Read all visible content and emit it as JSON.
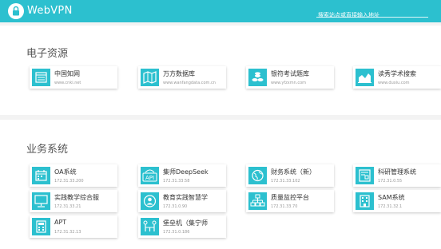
{
  "header": {
    "brand": "WebVPN",
    "search_placeholder": "搜索站点或直接输入地址"
  },
  "resources": {
    "title": "电子资源",
    "items": [
      {
        "name": "中国知网",
        "url": "www.cnki.net",
        "icon": "list-icon"
      },
      {
        "name": "万方数据库",
        "url": "www.wanfangdata.com.cn",
        "icon": "map-icon"
      },
      {
        "name": "银符考试题库",
        "url": "www.yfzxmn.com",
        "icon": "coins-icon"
      },
      {
        "name": "读秀学术搜索",
        "url": "www.duxiu.com",
        "icon": "chart-icon"
      }
    ]
  },
  "business": {
    "title": "业务系统",
    "items": [
      {
        "name": "OA系统",
        "url": "172.31.33.200",
        "icon": "calendar-icon"
      },
      {
        "name": "集师DeepSeek",
        "url": "172.31.33.58",
        "icon": "api-icon"
      },
      {
        "name": "财务系统（新）",
        "url": "172.31.33.102",
        "icon": "globe-icon"
      },
      {
        "name": "科研管理系统",
        "url": "172.31.0.55",
        "icon": "document-icon"
      },
      {
        "name": "实践教学综合服",
        "url": "172.31.33.21",
        "icon": "monitor-icon"
      },
      {
        "name": "教育实践智慧学",
        "url": "172.31.0.90",
        "icon": "user-icon"
      },
      {
        "name": "质量监控平台",
        "url": "172.31.33.70",
        "icon": "network-icon"
      },
      {
        "name": "SAM系统",
        "url": "172.31.32.1",
        "icon": "building-icon"
      },
      {
        "name": "APT",
        "url": "172.31.32.13",
        "icon": "calculator-icon"
      },
      {
        "name": "堡垒机（集宁师",
        "url": "172.31.0.186",
        "icon": "tree-icon"
      }
    ]
  }
}
